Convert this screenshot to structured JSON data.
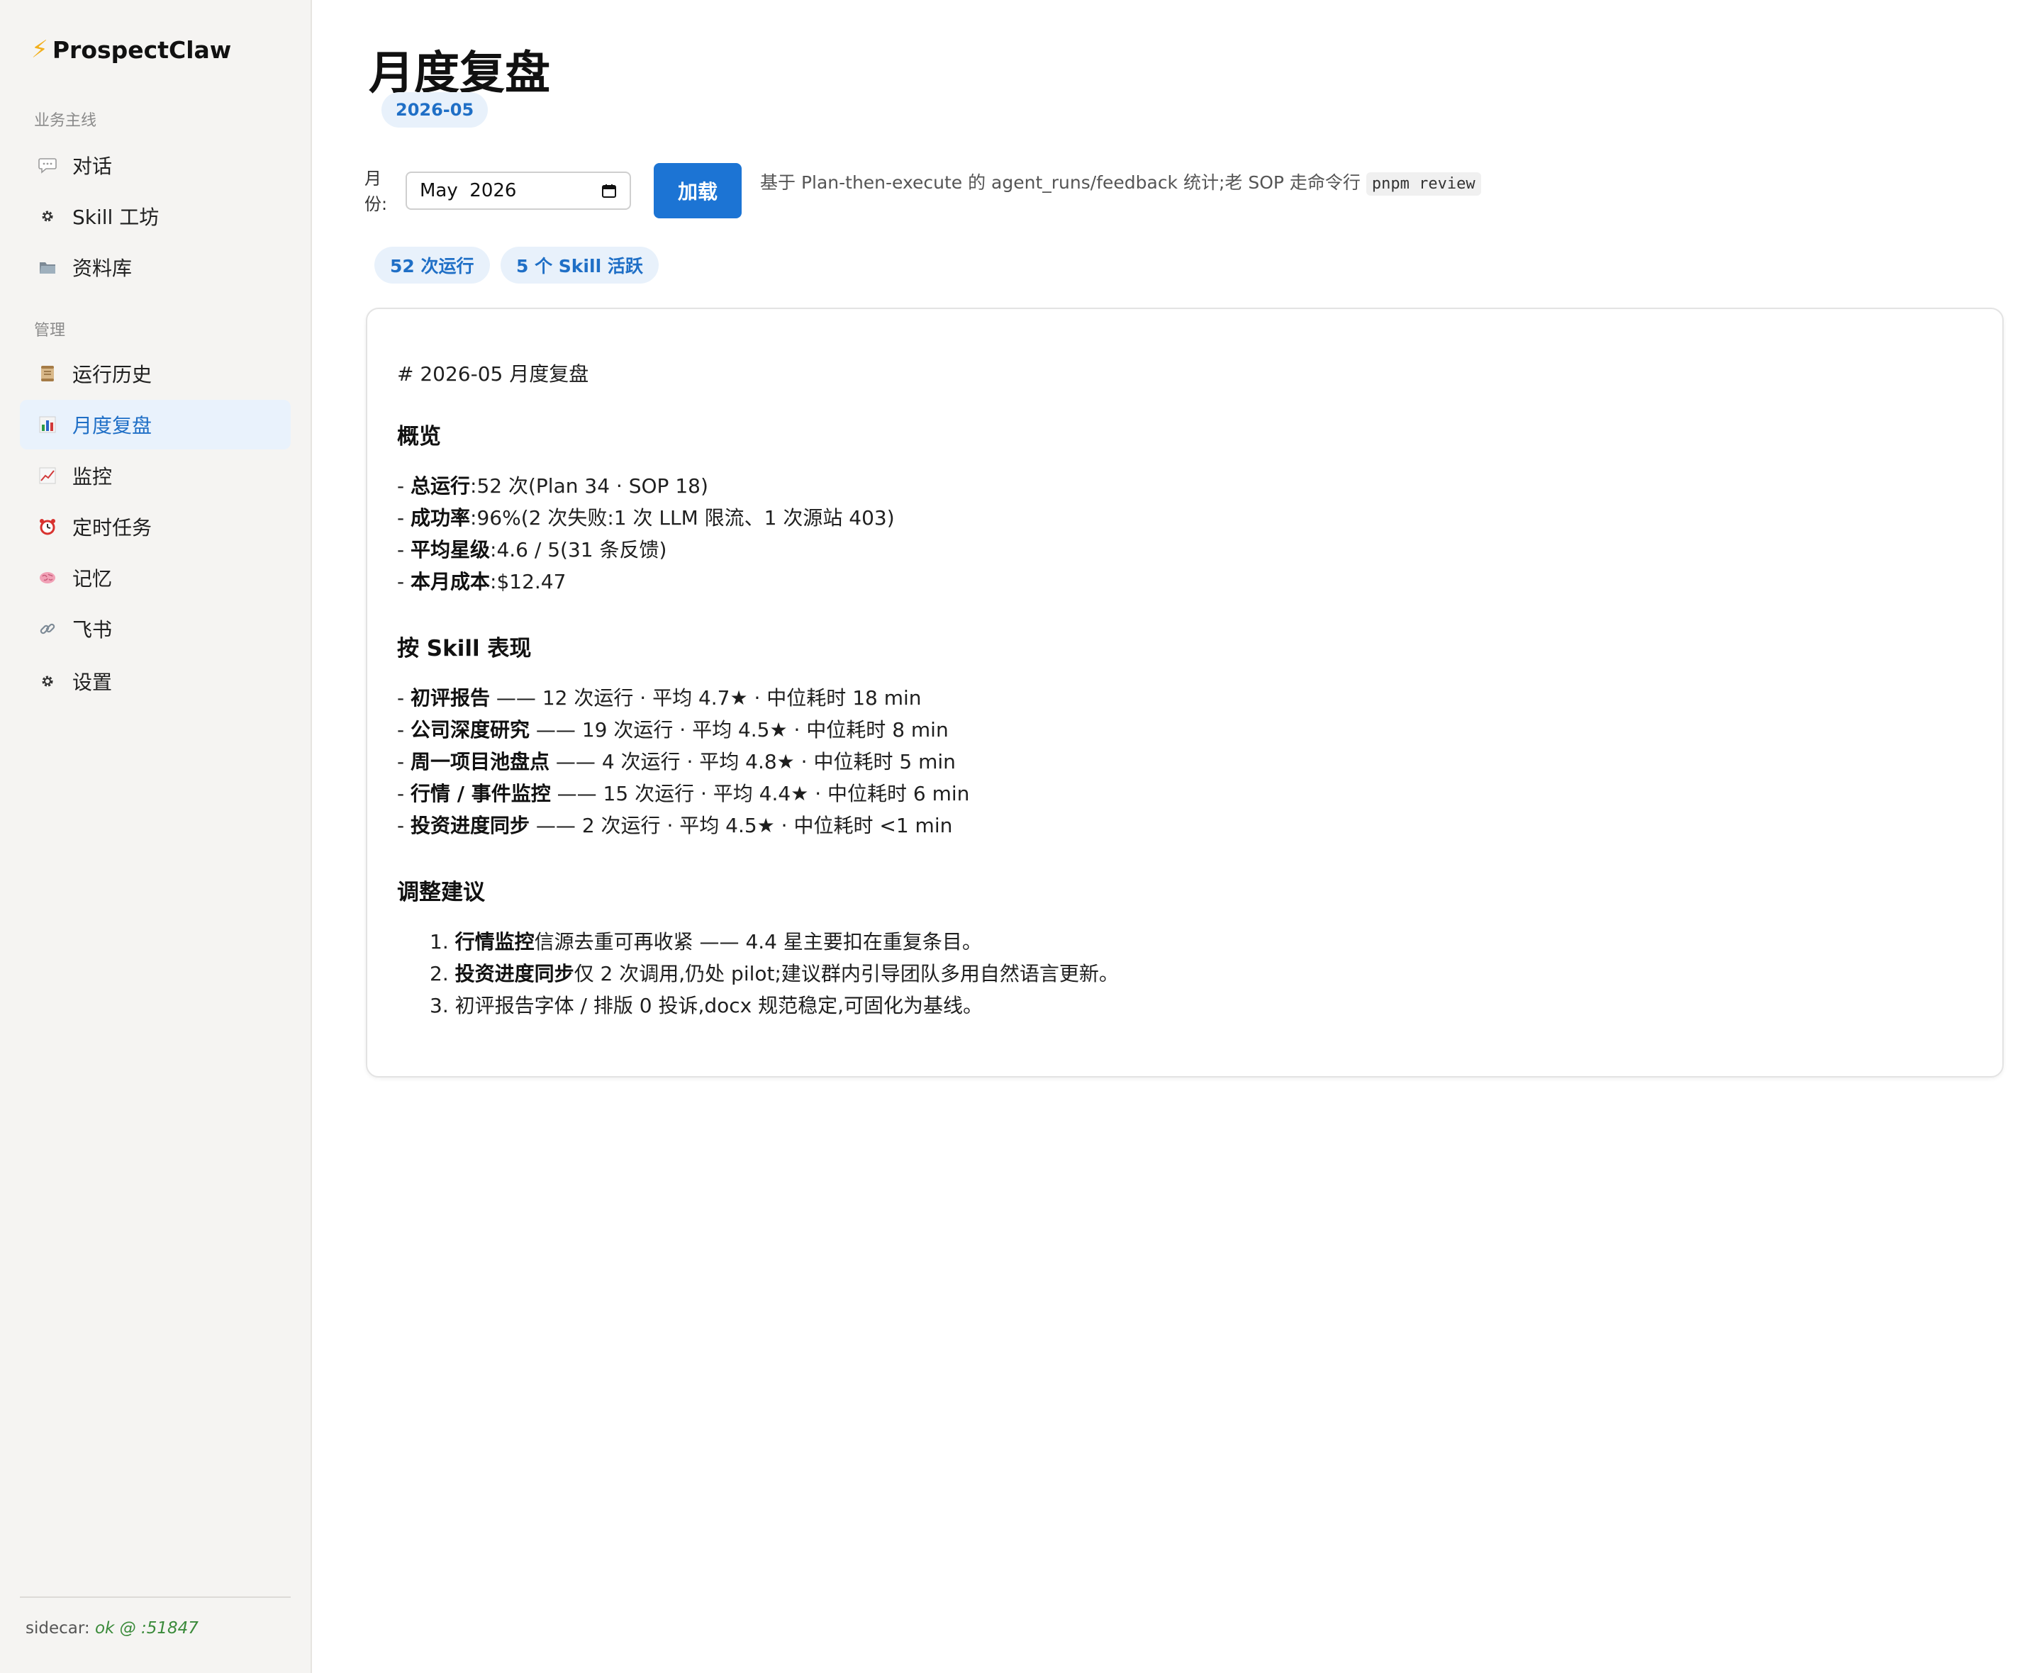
{
  "app": {
    "brand": "ProspectClaw",
    "brand_icon": "lightning-bolt-icon"
  },
  "sidebar": {
    "section_main": "业务主线",
    "section_admin": "管理",
    "items": [
      {
        "label": "对话",
        "icon": "chat-bubble-icon"
      },
      {
        "label": "Skill 工坊",
        "icon": "gear-icon"
      },
      {
        "label": "资料库",
        "icon": "folder-icon"
      },
      {
        "label": "运行历史",
        "icon": "scroll-icon"
      },
      {
        "label": "月度复盘",
        "icon": "bar-chart-icon",
        "active": true
      },
      {
        "label": "监控",
        "icon": "line-chart-icon"
      },
      {
        "label": "定时任务",
        "icon": "alarm-clock-icon"
      },
      {
        "label": "记忆",
        "icon": "brain-icon"
      },
      {
        "label": "飞书",
        "icon": "link-icon"
      },
      {
        "label": "设置",
        "icon": "gear-icon"
      }
    ],
    "footer": {
      "prefix": "sidecar:",
      "status": "ok @ :51847"
    }
  },
  "page": {
    "title": "月度复盘",
    "month_badge": "2026-05",
    "month_label": "月份:",
    "month_value": "May  2026",
    "load_button": "加载",
    "hint_prefix": "基于 Plan-then-execute 的 agent_runs/feedback 统计;老 SOP 走命令行",
    "hint_code": "pnpm review",
    "stats": [
      "52 次运行",
      "5 个 Skill 活跃"
    ]
  },
  "report": {
    "raw_heading": "# 2026-05 月度复盘",
    "overview": {
      "title": "概览",
      "lines": [
        {
          "key": "总运行",
          "text": ":52 次(Plan 34 · SOP 18)"
        },
        {
          "key": "成功率",
          "text": ":96%(2 次失败:1 次 LLM 限流、1 次源站 403)"
        },
        {
          "key": "平均星级",
          "text": ":4.6 / 5(31 条反馈)"
        },
        {
          "key": "本月成本",
          "text": ":$12.47"
        }
      ]
    },
    "by_skill": {
      "title": "按 Skill 表现",
      "lines": [
        {
          "key": "初评报告",
          "text": " —— 12 次运行 · 平均 4.7★ · 中位耗时 18 min"
        },
        {
          "key": "公司深度研究",
          "text": " —— 19 次运行 · 平均 4.5★ · 中位耗时 8 min"
        },
        {
          "key": "周一项目池盘点",
          "text": " —— 4 次运行 · 平均 4.8★ · 中位耗时 5 min"
        },
        {
          "key": "行情 / 事件监控",
          "text": " —— 15 次运行 · 平均 4.4★ · 中位耗时 6 min"
        },
        {
          "key": "投资进度同步",
          "text": " —— 2 次运行 · 平均 4.5★ · 中位耗时 <1 min"
        }
      ]
    },
    "suggestions": {
      "title": "调整建议",
      "items": [
        {
          "num": "1.",
          "key": "行情监控",
          "text": "信源去重可再收紧 —— 4.4 星主要扣在重复条目。"
        },
        {
          "num": "2.",
          "key": "投资进度同步",
          "text": "仅 2 次调用,仍处 pilot;建议群内引导团队多用自然语言更新。"
        },
        {
          "num": "3.",
          "key": "",
          "text": "初评报告字体 / 排版 0 投诉,docx 规范稳定,可固化为基线。"
        }
      ]
    }
  },
  "colors": {
    "accent": "#1c74d4",
    "accent_soft_bg": "#e8f1fb",
    "sidebar_bg": "#f5f4f2",
    "status_ok": "#3a8a3a"
  }
}
